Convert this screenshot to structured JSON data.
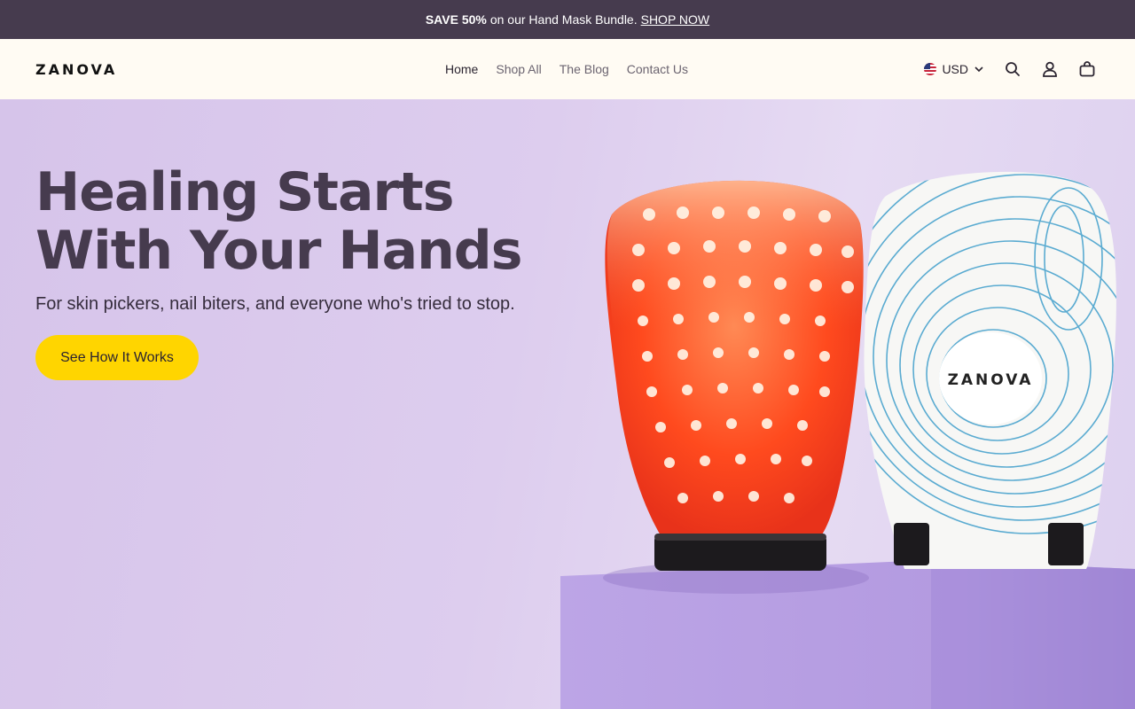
{
  "announcement": {
    "bold": "SAVE 50%",
    "text": "on our Hand Mask Bundle.",
    "link": "SHOP NOW"
  },
  "header": {
    "logo": "ZANOVA",
    "nav": [
      {
        "label": "Home",
        "active": true
      },
      {
        "label": "Shop All",
        "active": false
      },
      {
        "label": "The Blog",
        "active": false
      },
      {
        "label": "Contact Us",
        "active": false
      }
    ],
    "currency": "USD",
    "icons": [
      "flag-us-icon",
      "chevron-down-icon",
      "search-icon",
      "account-icon",
      "cart-icon"
    ]
  },
  "hero": {
    "title_line1": "Healing Starts",
    "title_line2": "With Your Hands",
    "subtitle": "For skin pickers, nail biters, and everyone who's tried to stop.",
    "cta": "See How It Works",
    "product_logo": "ZANOVA"
  },
  "colors": {
    "announcement_bg": "#463b4e",
    "header_bg": "#fffbf3",
    "hero_bg": "#dccbec",
    "cta_bg": "#ffd500",
    "title": "#463b4e"
  }
}
